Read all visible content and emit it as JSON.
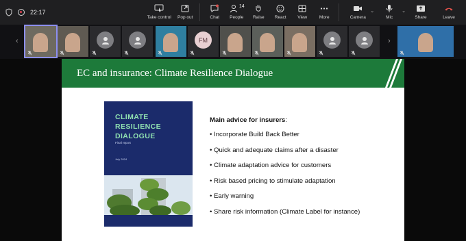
{
  "call": {
    "timer": "22:17"
  },
  "toolbar": {
    "buttons": [
      {
        "label": "Take control",
        "icon": "take-control-icon"
      },
      {
        "label": "Pop out",
        "icon": "pop-out-icon"
      },
      {
        "label": "Chat",
        "icon": "chat-icon"
      },
      {
        "label": "People",
        "icon": "people-icon",
        "count": "14"
      },
      {
        "label": "Raise",
        "icon": "raise-hand-icon"
      },
      {
        "label": "React",
        "icon": "react-icon"
      },
      {
        "label": "View",
        "icon": "view-icon"
      },
      {
        "label": "More",
        "icon": "more-icon"
      },
      {
        "label": "Camera",
        "icon": "camera-icon"
      },
      {
        "label": "Mic",
        "icon": "mic-icon"
      },
      {
        "label": "Share",
        "icon": "share-icon"
      },
      {
        "label": "Leave",
        "icon": "leave-phone-icon"
      }
    ]
  },
  "participants": [
    {
      "type": "video",
      "color": "#6e6a60"
    },
    {
      "type": "video",
      "color": "#5f5a52"
    },
    {
      "type": "avatar"
    },
    {
      "type": "avatar"
    },
    {
      "type": "video",
      "color": "#2f7fa0"
    },
    {
      "type": "initials",
      "initials": "FM"
    },
    {
      "type": "video",
      "color": "#50504c"
    },
    {
      "type": "video",
      "color": "#5b5f5a"
    },
    {
      "type": "video",
      "color": "#7a6e62"
    },
    {
      "type": "avatar"
    },
    {
      "type": "avatar"
    },
    {
      "type": "video",
      "color": "#2f6fa8"
    }
  ],
  "slide": {
    "title": "EC and insurance: Climate Resilience Dialogue",
    "header_color": "#1d7a3a",
    "report": {
      "title": "CLIMATE\nRESILIENCE\nDIALOGUE",
      "subtitle": "Final report",
      "date": "July 2024",
      "cover_color": "#1b2b6b",
      "title_color": "#8fe0b0"
    },
    "advice_heading": "Main advice for insurers",
    "advice_colon": ":",
    "advice_items": [
      "Incorporate Build Back Better",
      "Quick and adequate claims after a disaster",
      "Climate adaptation advice for customers",
      "Risk based pricing to stimulate adaptation",
      "Early warning",
      "Share risk information (Climate Label for instance)"
    ]
  }
}
